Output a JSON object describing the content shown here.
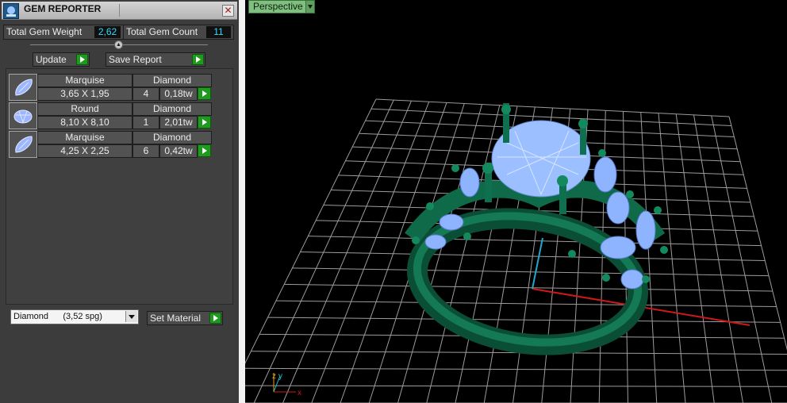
{
  "panel": {
    "title": "GEM REPORTER",
    "close": "✕",
    "total_weight_label": "Total Gem Weight",
    "total_weight_value": "2,62",
    "total_count_label": "Total Gem Count",
    "total_count_value": "11",
    "update_label": "Update",
    "save_report_label": "Save Report",
    "set_material_label": "Set Material",
    "material_select": "Diamond      (3,52 spg)"
  },
  "gems": [
    {
      "shape": "Marquise",
      "material": "Diamond",
      "size": "3,65 X 1,95",
      "count": "4",
      "weight": "0,18tw"
    },
    {
      "shape": "Round",
      "material": "Diamond",
      "size": "8,10 X 8,10",
      "count": "1",
      "weight": "2,01tw"
    },
    {
      "shape": "Marquise",
      "material": "Diamond",
      "size": "4,25 X 2,25",
      "count": "6",
      "weight": "0,42tw"
    }
  ],
  "viewport": {
    "view_label": "Perspective",
    "axis_x": "x",
    "axis_y": "y",
    "axis_z": "z"
  },
  "colors": {
    "panel_bg": "#3c3c3c",
    "accent_green": "#1e9a1e",
    "value_cyan": "#36d8ff",
    "ring_green": "#0d5a3c",
    "gem_blue": "#8fb4ff",
    "grid": "#b8b8b8",
    "axis_x": "#d01818",
    "axis_y": "#20a8c8"
  }
}
